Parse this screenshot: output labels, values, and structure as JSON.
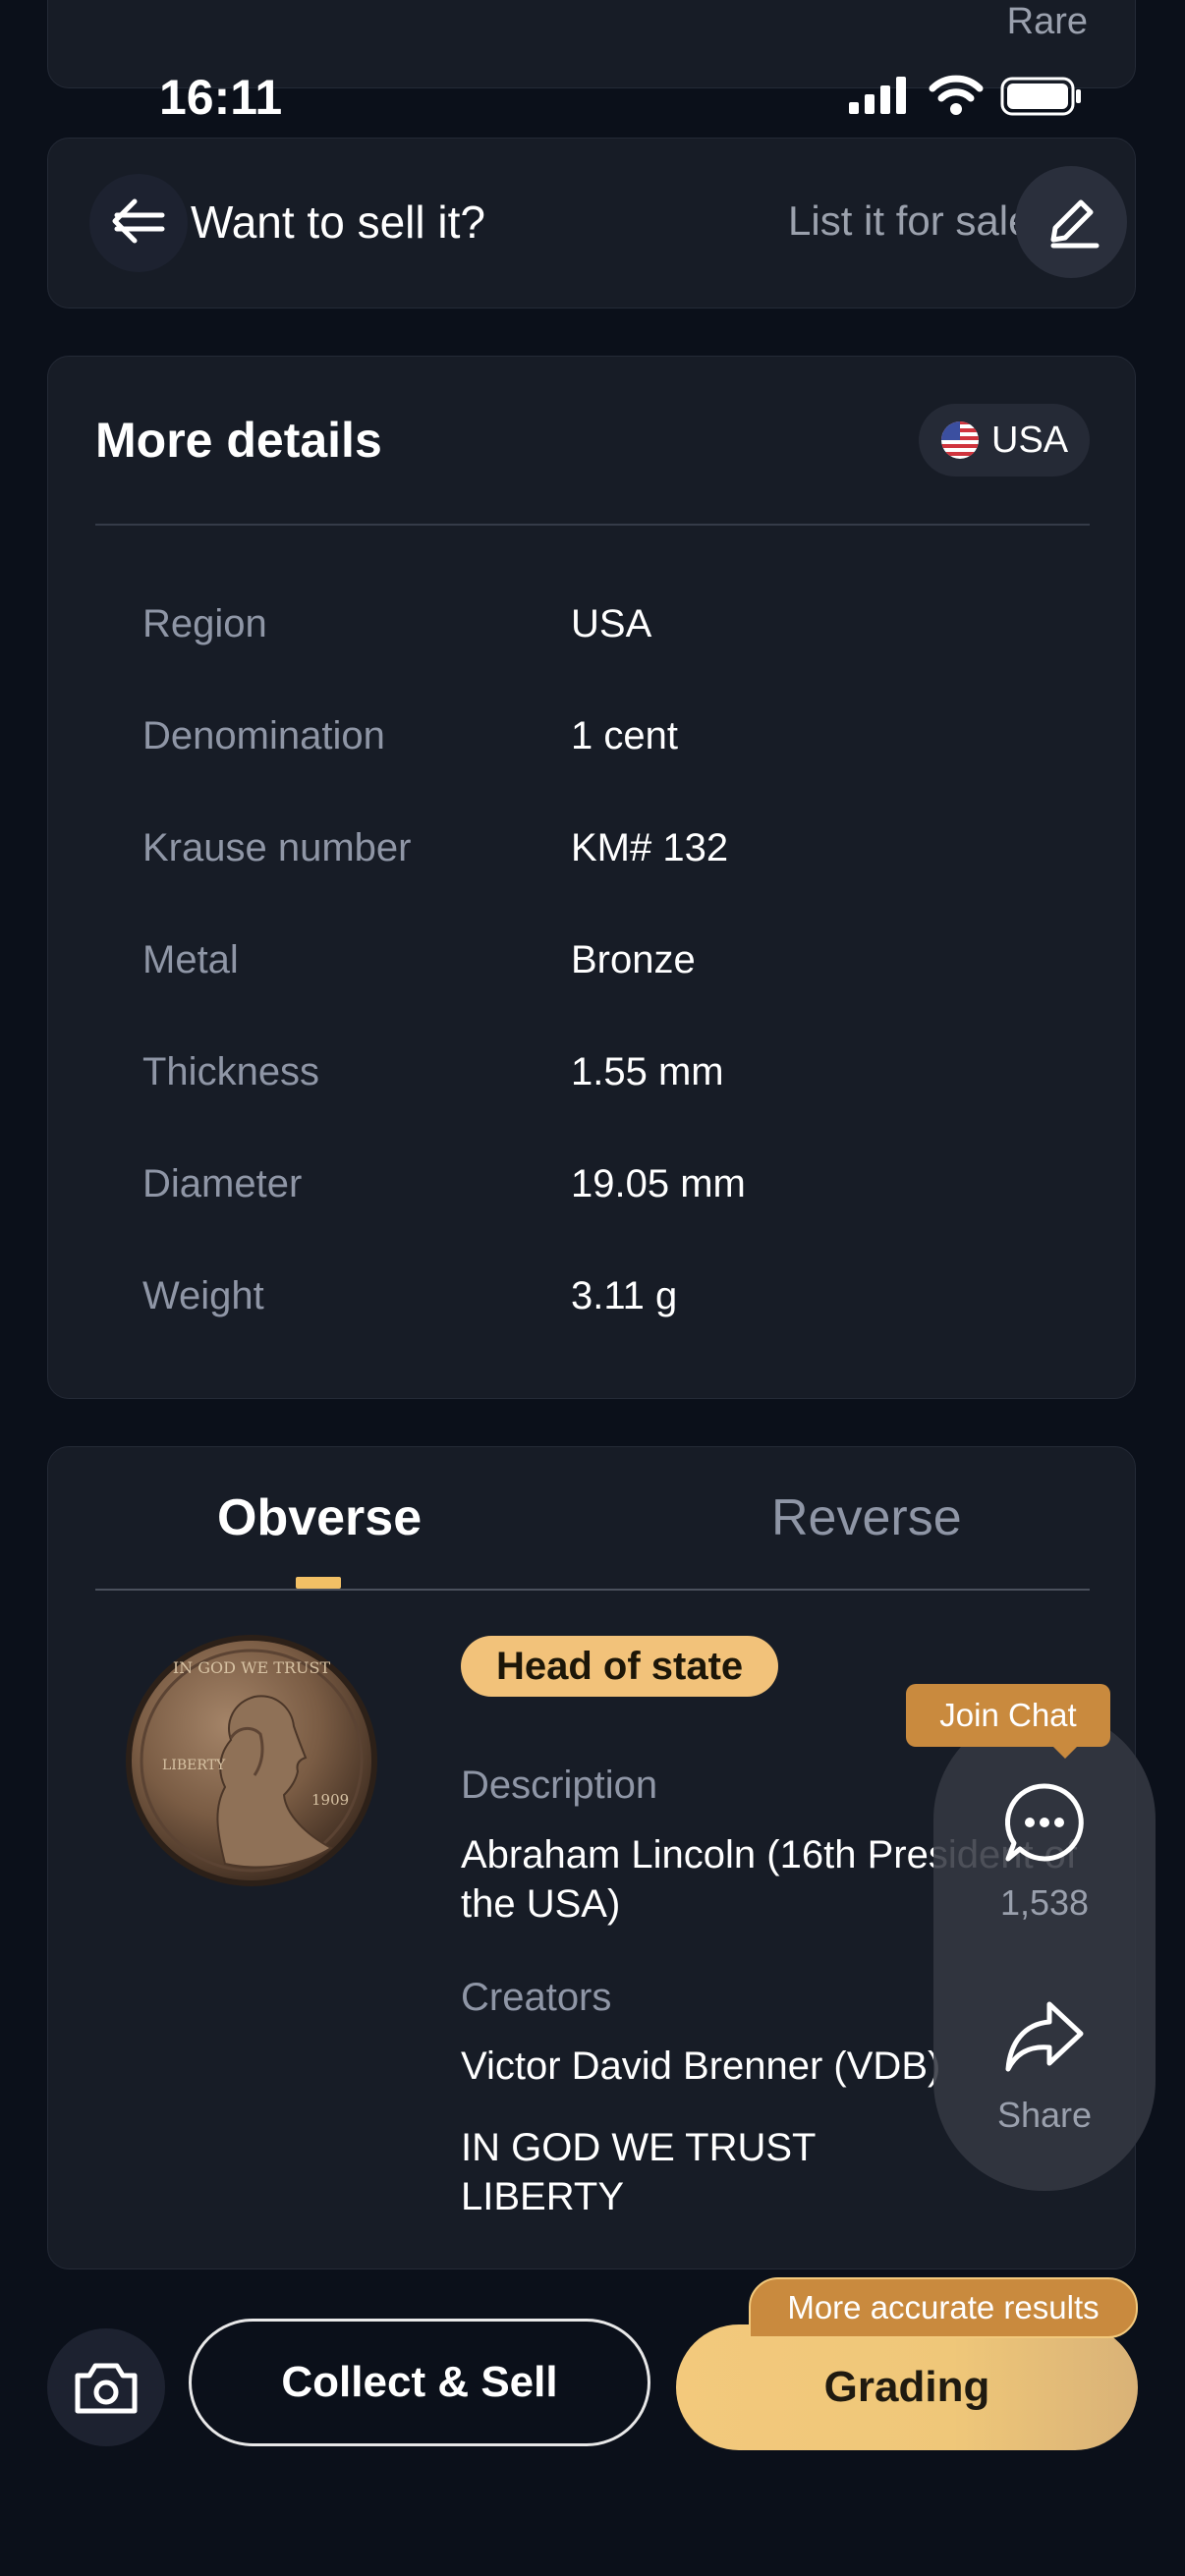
{
  "top_card": {
    "label": "Rare"
  },
  "status_bar": {
    "time": "16:11"
  },
  "sell_banner": {
    "title": "Want to sell it?",
    "link_text": "List it for sale"
  },
  "details": {
    "title": "More details",
    "region_chip": "USA",
    "rows": [
      {
        "label": "Region",
        "value": "USA"
      },
      {
        "label": "Denomination",
        "value": "1 cent"
      },
      {
        "label": "Krause number",
        "value": "KM# 132"
      },
      {
        "label": "Metal",
        "value": "Bronze"
      },
      {
        "label": "Thickness",
        "value": "1.55 mm"
      },
      {
        "label": "Diameter",
        "value": "19.05 mm"
      },
      {
        "label": "Weight",
        "value": "3.11 g"
      }
    ]
  },
  "coin_side": {
    "tabs": [
      "Obverse",
      "Reverse"
    ],
    "active_tab": "Obverse",
    "tag": "Head of state",
    "description_label": "Description",
    "description": "Abraham Lincoln (16th President of the USA)",
    "creators_label": "Creators",
    "creators": "Victor David Brenner (VDB)",
    "inscription_line1": "IN GOD WE TRUST",
    "inscription_line2": "LIBERTY"
  },
  "floating": {
    "join_chat": "Join Chat",
    "chat_count": "1,538",
    "share_label": "Share"
  },
  "bottom_bar": {
    "collect_sell": "Collect & Sell",
    "grading": "Grading",
    "grading_badge": "More accurate results"
  },
  "colors": {
    "background": "#0b101a",
    "card": "#171c26",
    "accent_gold": "#f2c065",
    "badge_orange": "#c98a3e"
  }
}
